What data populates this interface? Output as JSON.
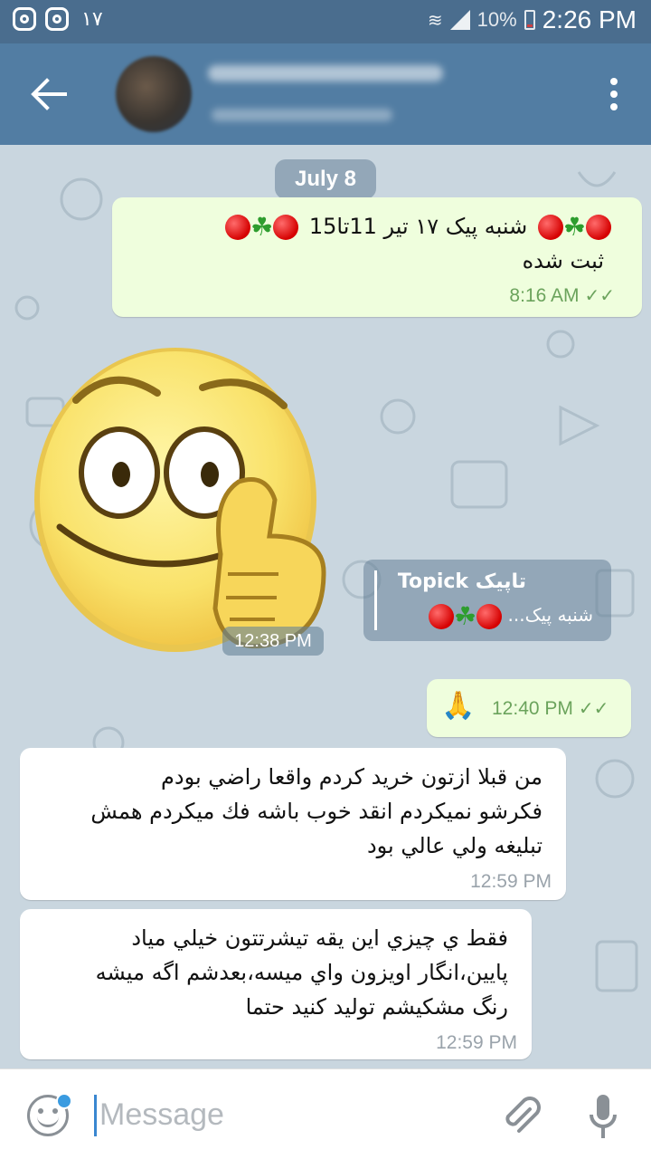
{
  "statusbar": {
    "left_number": "١٧",
    "battery": "10%",
    "time": "2:26 PM"
  },
  "header": {
    "back_icon": "arrow-left-icon",
    "menu_icon": "more-vert-icon"
  },
  "chat": {
    "date": "July 8",
    "messages": [
      {
        "line1_text": "شنبه پیک  ١٧ تیر 11تا15",
        "line2_text": "ثبت شده",
        "time": "8:16 AM"
      },
      {
        "sticker": "thumbs-up-smiley-sticker",
        "time": "12:38 PM",
        "reply_title": "Topick تاپیک",
        "reply_text": "شنبه پیک..."
      },
      {
        "emoji": "🙏",
        "time": "12:40 PM"
      },
      {
        "lines": [
          "من قبلا ازتون خريد كردم واقعا راضي بودم",
          "فكرشو نميكردم انقد خوب باشه فك ميكردم همش",
          "تبليغه ولي عالي بود"
        ],
        "time": "12:59 PM"
      },
      {
        "lines": [
          "فقط ي  چيزي اين يقه تيشرتتون خيلي مياد",
          "پايين،انگار اويزون واي ميسه،بعدشم اگه ميشه",
          "رنگ مشكيشم توليد كنيد حتما"
        ],
        "time": "12:59 PM"
      }
    ]
  },
  "input": {
    "placeholder": "Message"
  },
  "colors": {
    "header": "#527da3",
    "statusbar": "#4a6d8e",
    "outgoing_bubble": "#effedd",
    "incoming_bubble": "#ffffff",
    "chat_background": "#c9d6df"
  }
}
